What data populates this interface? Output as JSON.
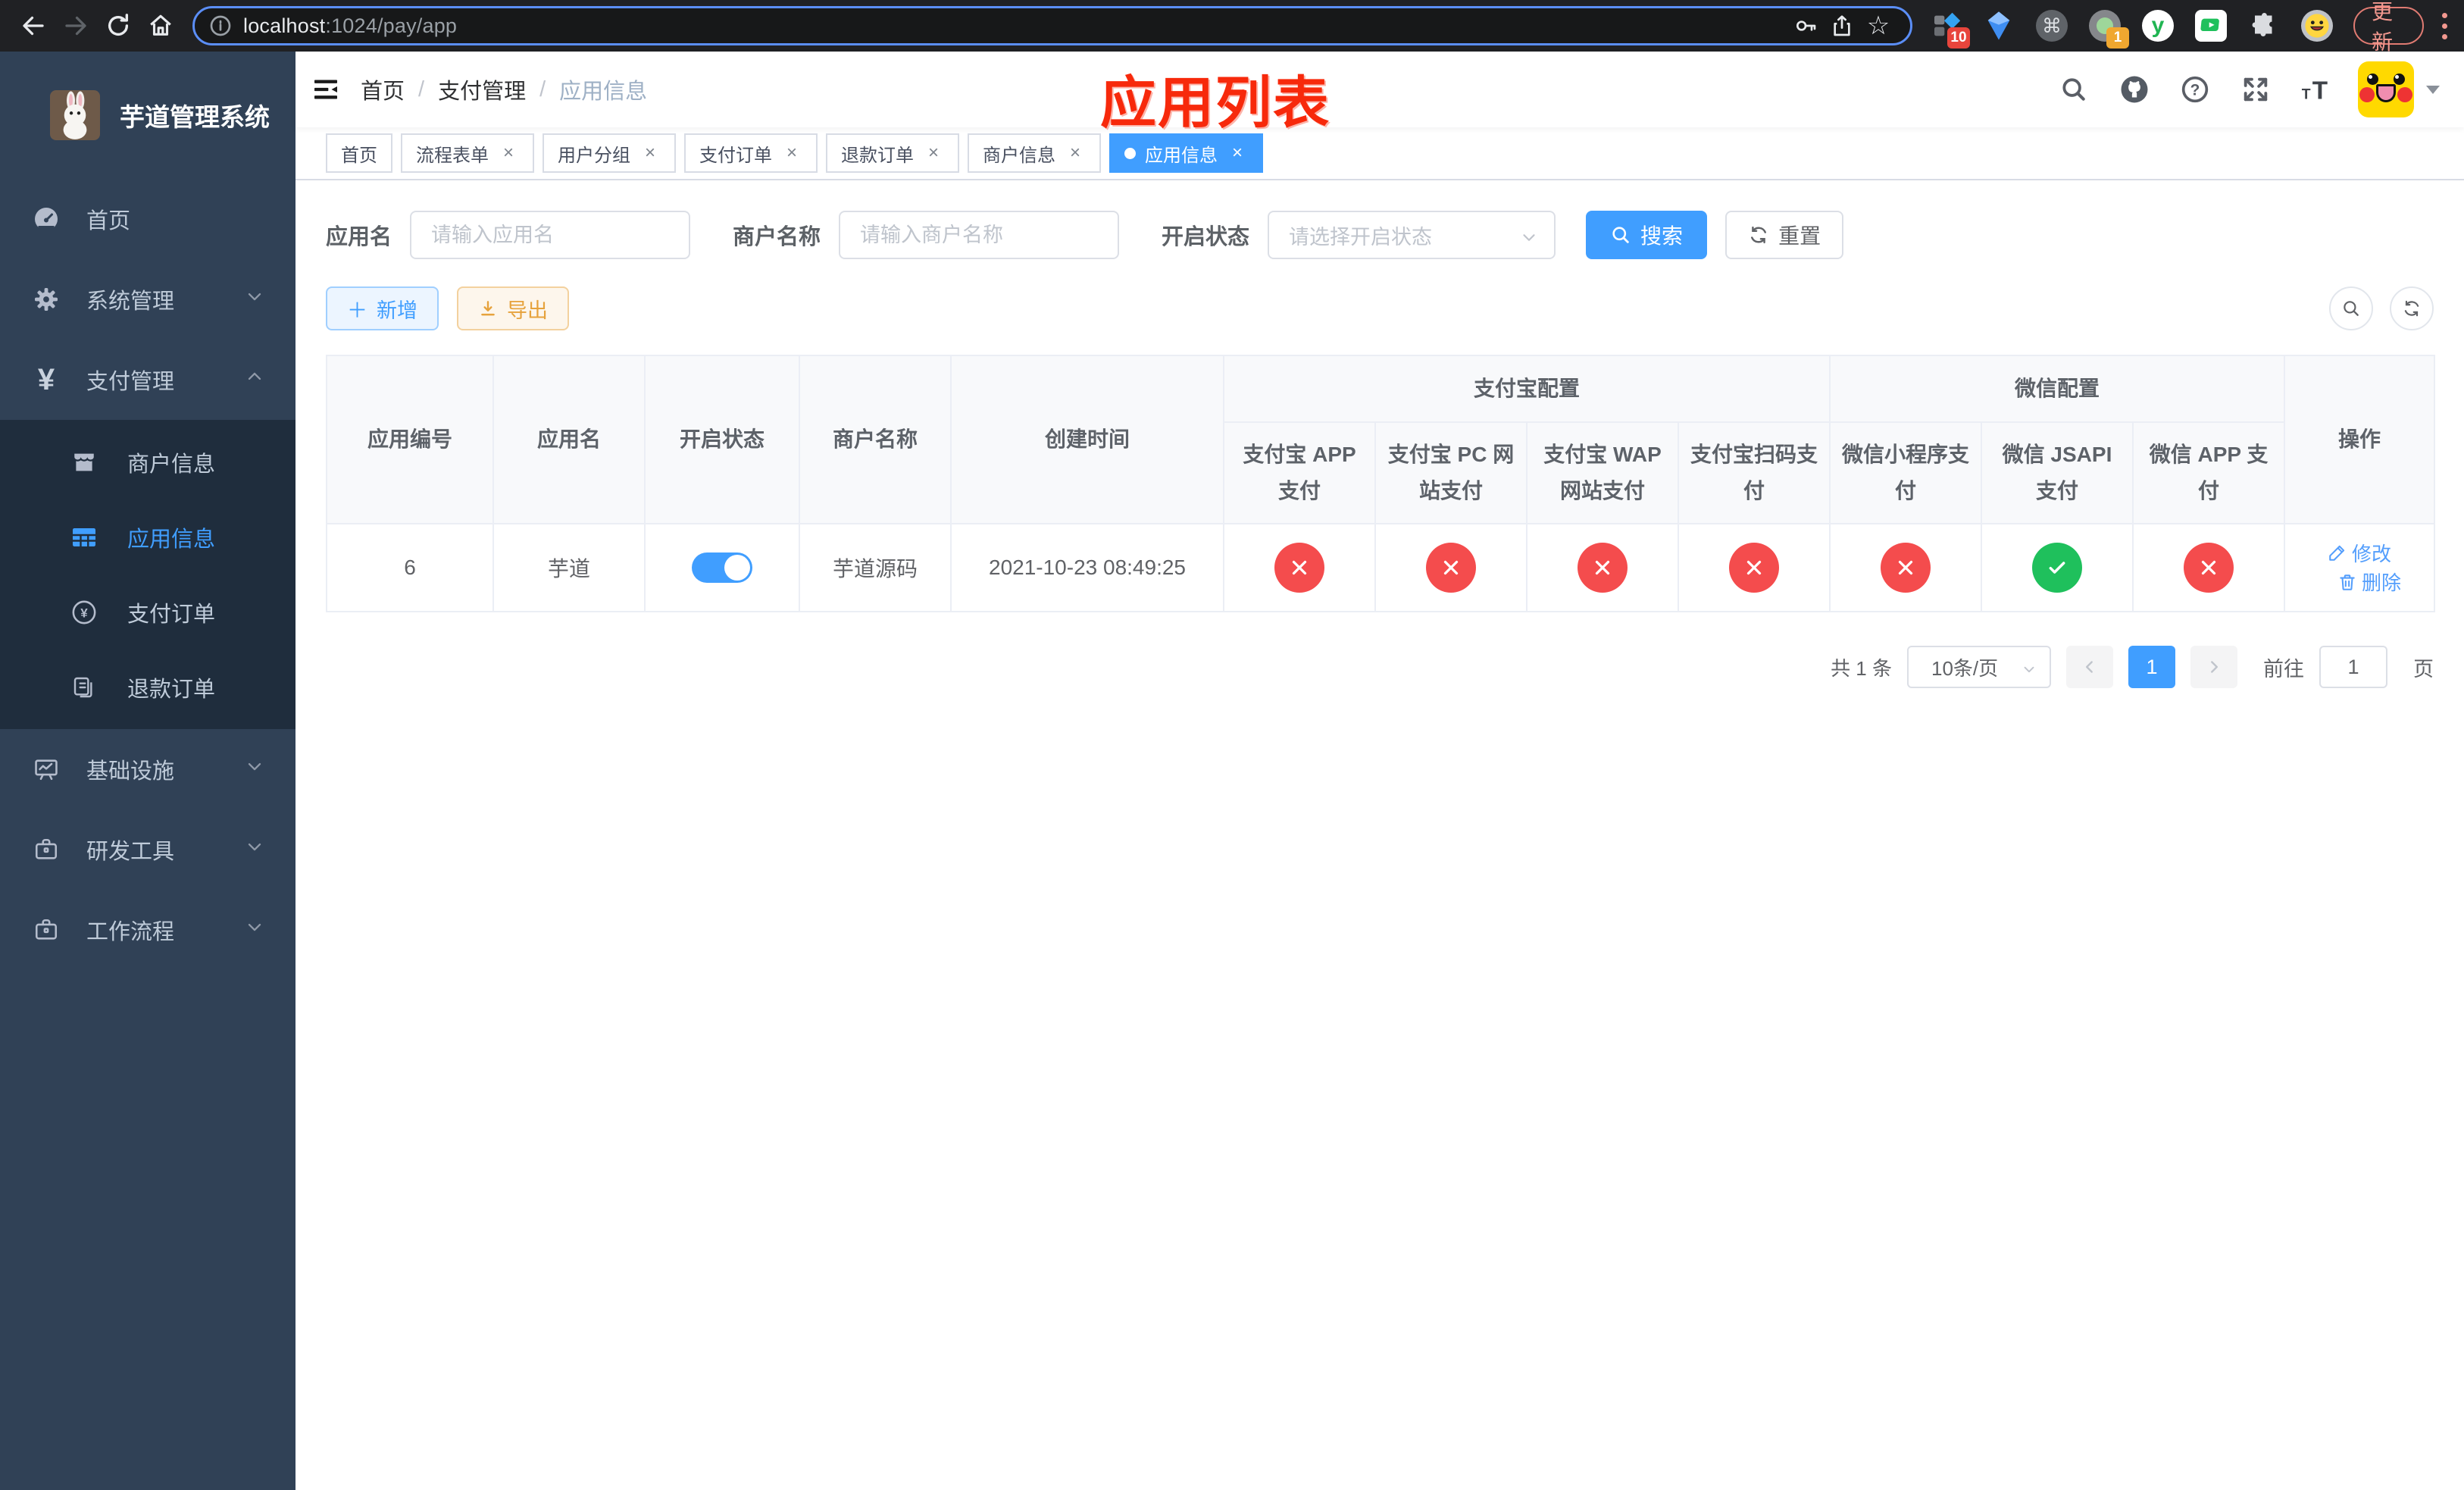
{
  "browser": {
    "url_host": "localhost",
    "url_rest": ":1024/pay/app",
    "ext_badge_blocker": "10",
    "ext_badge_recorder": "1",
    "update_label": "更新"
  },
  "sidebar": {
    "title": "芋道管理系统",
    "items": [
      {
        "label": "首页"
      },
      {
        "label": "系统管理"
      },
      {
        "label": "支付管理",
        "children": [
          {
            "label": "商户信息"
          },
          {
            "label": "应用信息"
          },
          {
            "label": "支付订单"
          },
          {
            "label": "退款订单"
          }
        ]
      },
      {
        "label": "基础设施"
      },
      {
        "label": "研发工具"
      },
      {
        "label": "工作流程"
      }
    ]
  },
  "breadcrumb": {
    "items": [
      "首页",
      "支付管理",
      "应用信息"
    ]
  },
  "annotation": {
    "title": "应用列表"
  },
  "tabs": [
    {
      "label": "首页"
    },
    {
      "label": "流程表单"
    },
    {
      "label": "用户分组"
    },
    {
      "label": "支付订单"
    },
    {
      "label": "退款订单"
    },
    {
      "label": "商户信息"
    },
    {
      "label": "应用信息"
    }
  ],
  "filters": {
    "app_name": {
      "label": "应用名",
      "placeholder": "请输入应用名",
      "value": ""
    },
    "merchant_name": {
      "label": "商户名称",
      "placeholder": "请输入商户名称",
      "value": ""
    },
    "open_status": {
      "label": "开启状态",
      "placeholder": "请选择开启状态"
    },
    "search_label": "搜索",
    "reset_label": "重置"
  },
  "toolbar": {
    "add_label": "新增",
    "export_label": "导出"
  },
  "table": {
    "columns": {
      "id": "应用编号",
      "name": "应用名",
      "status": "开启状态",
      "merchant": "商户名称",
      "created": "创建时间",
      "alipay_group": "支付宝配置",
      "wechat_group": "微信配置",
      "alipay": [
        "支付宝 APP 支付",
        "支付宝 PC 网站支付",
        "支付宝 WAP 网站支付",
        "支付宝扫码支付"
      ],
      "wechat": [
        "微信小程序支付",
        "微信 JSAPI 支付",
        "微信 APP 支付"
      ],
      "actions": "操作"
    },
    "rows": [
      {
        "id": "6",
        "name": "芋道",
        "enabled": true,
        "merchant": "芋道源码",
        "created": "2021-10-23 08:49:25",
        "pay_status": {
          "alipay_app": false,
          "alipay_pc": false,
          "alipay_wap": false,
          "alipay_qr": false,
          "wechat_lite": false,
          "wechat_jsapi": true,
          "wechat_app": false
        }
      }
    ],
    "action_labels": {
      "edit": "修改",
      "delete": "删除"
    }
  },
  "pagination": {
    "total": "共 1 条",
    "page_size": "10条/页",
    "current_page": "1",
    "goto_label": "前往",
    "goto_value": "1",
    "page_unit": "页"
  },
  "theme": {
    "accent": "#409eff",
    "success": "#1fc05c",
    "danger": "#f44c4d",
    "warning": "#e6a23c",
    "sidebar_bg": "#304156",
    "submenu_bg": "#1f2d3d",
    "annotation_red": "#f7290b"
  }
}
